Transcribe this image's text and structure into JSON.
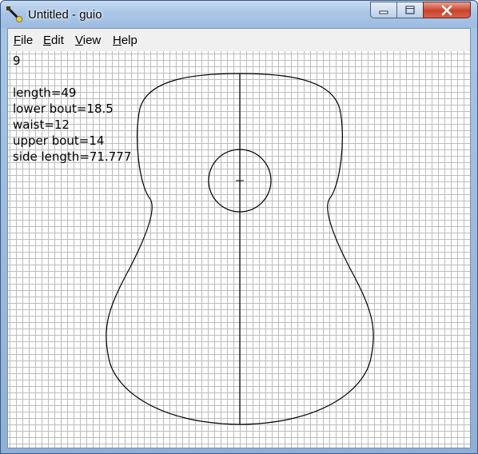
{
  "window": {
    "title": "Untitled - guio"
  },
  "menu": {
    "items": [
      {
        "label": "File",
        "accel": "F",
        "rest": "ile"
      },
      {
        "label": "Edit",
        "accel": "E",
        "rest": "dit"
      },
      {
        "label": "View",
        "accel": "V",
        "rest": "iew"
      },
      {
        "label": "Help",
        "accel": "H",
        "rest": "elp"
      }
    ]
  },
  "canvas": {
    "counter": "9",
    "params": [
      "length=49",
      "lower bout=18.5",
      "waist=12",
      "upper bout=14",
      "side length=71.777"
    ]
  },
  "colors": {
    "grid": "#bdbdbd",
    "outline": "#000000",
    "titlebar": "#a9c6e6",
    "close": "#c8432c"
  },
  "icons": [
    "app-guitar-icon",
    "minimize-icon",
    "maximize-icon",
    "close-icon"
  ]
}
